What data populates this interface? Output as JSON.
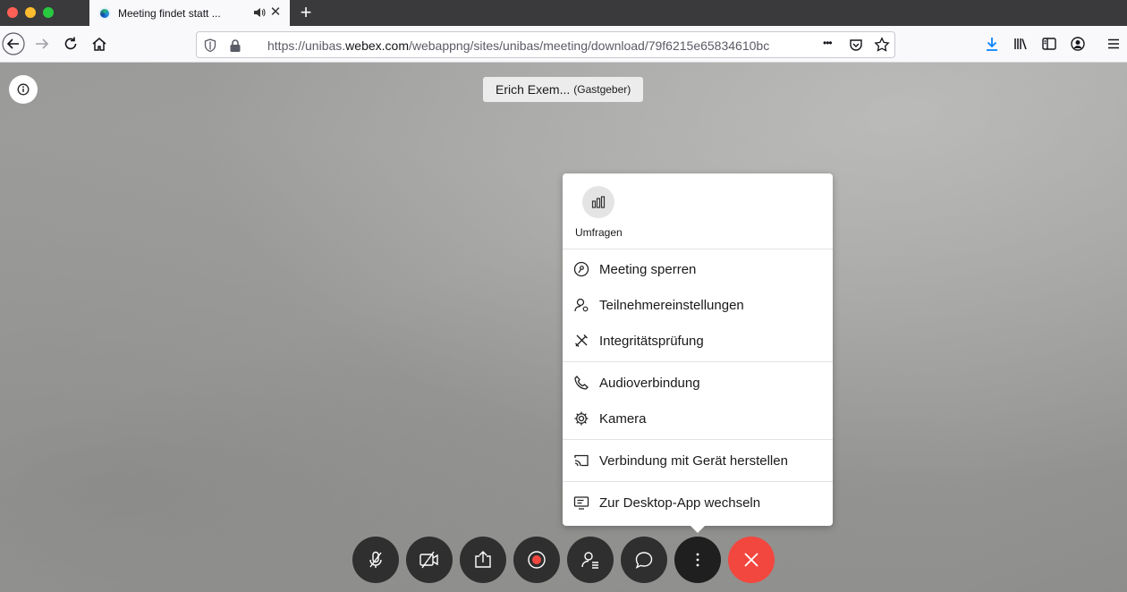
{
  "browser": {
    "tab": {
      "title": "Meeting findet statt ...",
      "close_glyph": "✕"
    },
    "new_tab_glyph": "+",
    "url": {
      "prefix": "https://unibas.",
      "domain": "webex.com",
      "path": "/webappng/sites/unibas/meeting/download/79f6215e65834610bc",
      "menu_glyph": "•••"
    }
  },
  "meeting": {
    "host_name": "Erich Exem...",
    "host_role": "(Gastgeber)"
  },
  "menu": {
    "poll_label": "Umfragen",
    "items": [
      {
        "label": "Meeting sperren",
        "icon": "lock-meeting-icon"
      },
      {
        "label": "Teilnehmereinstellungen",
        "icon": "participant-settings-icon"
      },
      {
        "label": "Integritätsprüfung",
        "icon": "tools-icon"
      },
      {
        "label": "Audioverbindung",
        "icon": "phone-icon"
      },
      {
        "label": "Kamera",
        "icon": "gear-icon"
      },
      {
        "label": "Verbindung mit Gerät herstellen",
        "icon": "cast-icon"
      },
      {
        "label": "Zur Desktop-App wechseln",
        "icon": "desktop-app-icon"
      }
    ]
  },
  "controls": [
    "mute-icon",
    "camera-off-icon",
    "share-icon",
    "record-icon",
    "participants-icon",
    "chat-icon",
    "more-icon",
    "leave-icon"
  ],
  "colors": {
    "end_call": "#f2473f",
    "record": "#f2473f",
    "download_accent": "#0a84ff"
  }
}
